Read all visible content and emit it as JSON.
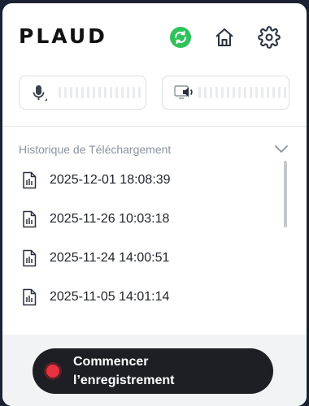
{
  "header": {
    "logo": "PLAUD",
    "colors": {
      "sync": "#2fc25b",
      "record": "#e8323f"
    },
    "icons": [
      "sync-icon",
      "home-icon",
      "gear-icon",
      "microphone-icon",
      "speaker-icon"
    ]
  },
  "history": {
    "title": "Historique de Téléchargement",
    "items": [
      {
        "icon": "audio-file-icon",
        "label": "2025-12-01 18:08:39"
      },
      {
        "icon": "audio-file-icon",
        "label": "2025-11-26 10:03:18"
      },
      {
        "icon": "audio-file-icon",
        "label": "2025-11-24 14:00:51"
      },
      {
        "icon": "audio-file-icon",
        "label": "2025-11-05 14:01:14"
      }
    ]
  },
  "footer": {
    "record_label": "Commencer l’enregistrement"
  }
}
